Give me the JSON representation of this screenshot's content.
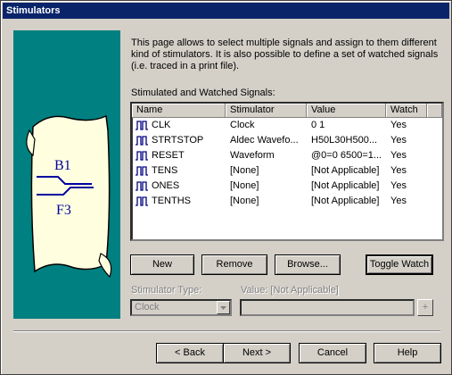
{
  "window": {
    "title": "Stimulators"
  },
  "description": "This page allows to select multiple signals and assign to them different kind of stimulators. It is also possible to define a set of watched signals (i.e. traced in a print file).",
  "banner": {
    "label_top": "B1",
    "label_bottom": "F3",
    "colors": {
      "background": "#008080",
      "scroll": "#ffffe0"
    }
  },
  "list": {
    "label": "Stimulated and Watched Signals:",
    "columns": [
      "Name",
      "Stimulator",
      "Value",
      "Watch"
    ],
    "rows": [
      {
        "name": "CLK",
        "stimulator": "Clock",
        "value": "0 1",
        "watch": "Yes"
      },
      {
        "name": "STRTSTOP",
        "stimulator": "Aldec Wavefo...",
        "value": "H50L30H500...",
        "watch": "Yes"
      },
      {
        "name": "RESET",
        "stimulator": "Waveform",
        "value": "@0=0 6500=1...",
        "watch": "Yes"
      },
      {
        "name": "TENS",
        "stimulator": "[None]",
        "value": "[Not Applicable]",
        "watch": "Yes"
      },
      {
        "name": "ONES",
        "stimulator": "[None]",
        "value": "[Not Applicable]",
        "watch": "Yes"
      },
      {
        "name": "TENTHS",
        "stimulator": "[None]",
        "value": "[Not Applicable]",
        "watch": "Yes"
      }
    ]
  },
  "list_buttons": {
    "new": "New",
    "remove": "Remove",
    "browse": "Browse...",
    "toggle_watch": "Toggle Watch"
  },
  "stimulator_type": {
    "label": "Stimulator Type:",
    "value": "Clock"
  },
  "value_field": {
    "label": "Value: [Not Applicable]",
    "plus": "+"
  },
  "nav_buttons": {
    "back": "< Back",
    "next": "Next >",
    "cancel": "Cancel",
    "help": "Help"
  }
}
